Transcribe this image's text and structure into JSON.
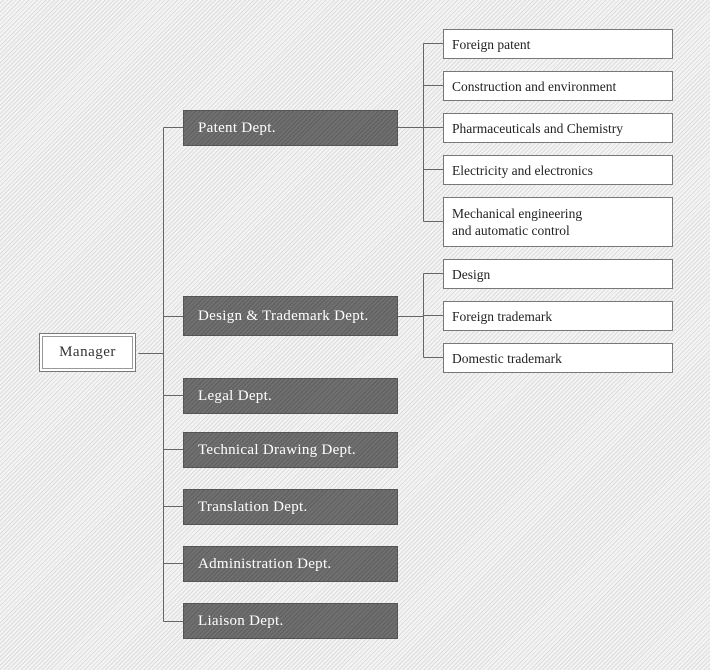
{
  "manager": "Manager",
  "departments": [
    {
      "label": "Patent Dept.",
      "children": [
        "Foreign patent",
        "Construction and environment",
        "Pharmaceuticals and Chemistry",
        "Electricity and electronics",
        "Mechanical engineering\nand automatic control"
      ]
    },
    {
      "label": "Design & Trademark Dept.",
      "children": [
        "Design",
        "Foreign trademark",
        "Domestic trademark"
      ]
    },
    {
      "label": "Legal Dept."
    },
    {
      "label": "Technical Drawing Dept."
    },
    {
      "label": "Translation Dept."
    },
    {
      "label": "Administration Dept."
    },
    {
      "label": "Liaison Dept."
    }
  ]
}
